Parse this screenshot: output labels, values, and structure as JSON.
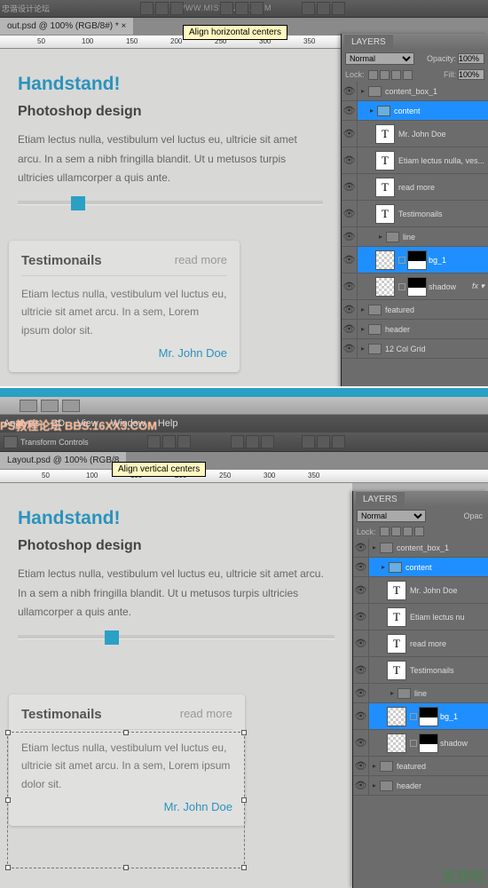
{
  "watermarks": {
    "top_left": "忠谐设计论坛",
    "top_url": "WWW.MISSYUAN.COM",
    "mid": "PS教程论坛\nBBS.16XX3.COM",
    "bottom_right": "发现吧"
  },
  "top": {
    "doc_tab": "out.psd @ 100% (RGB/8#) * ×",
    "tooltip": "Align horizontal centers",
    "ruler": [
      "50",
      "100",
      "150",
      "200",
      "250",
      "300",
      "350"
    ],
    "hero_title": "Handstand!",
    "hero_sub": "Photoshop design",
    "hero_body": "Etiam lectus nulla, vestibulum vel luctus eu, ultricie sit amet arcu. In a sem a nibh fringilla blandit. Ut u metusos turpis ultricies ullamcorper a quis ante.",
    "testi_title": "Testimonails",
    "testi_more": "read more",
    "testi_body": "Etiam lectus nulla, vestibulum vel luctus eu, ultricie sit amet arcu. In a sem, Lorem ipsum dolor sit.",
    "testi_author": "Mr. John Doe"
  },
  "layers_panel": {
    "tab": "LAYERS",
    "blend": "Normal",
    "opacity_lbl": "Opacity:",
    "opacity": "100%",
    "lock_lbl": "Lock:",
    "fill_lbl": "Fill:",
    "fill": "100%"
  },
  "layers_top": [
    {
      "type": "folder",
      "indent": 0,
      "name": "content_box_1"
    },
    {
      "type": "folder",
      "indent": 1,
      "name": "content",
      "sel": true,
      "blue": true
    },
    {
      "type": "text",
      "indent": 2,
      "name": "Mr. John Doe"
    },
    {
      "type": "text",
      "indent": 2,
      "name": "Etiam lectus nulla, ves..."
    },
    {
      "type": "text",
      "indent": 2,
      "name": "read more"
    },
    {
      "type": "text",
      "indent": 2,
      "name": "Testimonails"
    },
    {
      "type": "folder",
      "indent": 2,
      "name": "line"
    },
    {
      "type": "mask",
      "indent": 2,
      "name": "bg_1",
      "sel": true
    },
    {
      "type": "mask",
      "indent": 2,
      "name": "shadow",
      "fx": "fx"
    },
    {
      "type": "folder",
      "indent": 0,
      "name": "featured"
    },
    {
      "type": "folder",
      "indent": 0,
      "name": "header"
    },
    {
      "type": "folder",
      "indent": 0,
      "name": "12 Col Grid"
    }
  ],
  "bot": {
    "menu": [
      "Analysis",
      "3D",
      "View",
      "Window",
      "Help"
    ],
    "opt_label": "Transform Controls",
    "doc_tab": "Layout.psd @ 100% (RGB/8",
    "tooltip": "Align vertical centers",
    "ruler": [
      "50",
      "100",
      "150",
      "200",
      "250",
      "300",
      "350"
    ]
  },
  "layers_bot": [
    {
      "type": "folder",
      "indent": 0,
      "name": "content_box_1"
    },
    {
      "type": "folder",
      "indent": 1,
      "name": "content",
      "sel": true,
      "blue": true
    },
    {
      "type": "text",
      "indent": 2,
      "name": "Mr. John Doe"
    },
    {
      "type": "text",
      "indent": 2,
      "name": "Etiam lectus nu"
    },
    {
      "type": "text",
      "indent": 2,
      "name": "read more"
    },
    {
      "type": "text",
      "indent": 2,
      "name": "Testimonails"
    },
    {
      "type": "folder",
      "indent": 2,
      "name": "line"
    },
    {
      "type": "mask",
      "indent": 2,
      "name": "bg_1",
      "sel": true
    },
    {
      "type": "mask",
      "indent": 2,
      "name": "shadow"
    },
    {
      "type": "folder",
      "indent": 0,
      "name": "featured"
    },
    {
      "type": "folder",
      "indent": 0,
      "name": "header"
    }
  ]
}
